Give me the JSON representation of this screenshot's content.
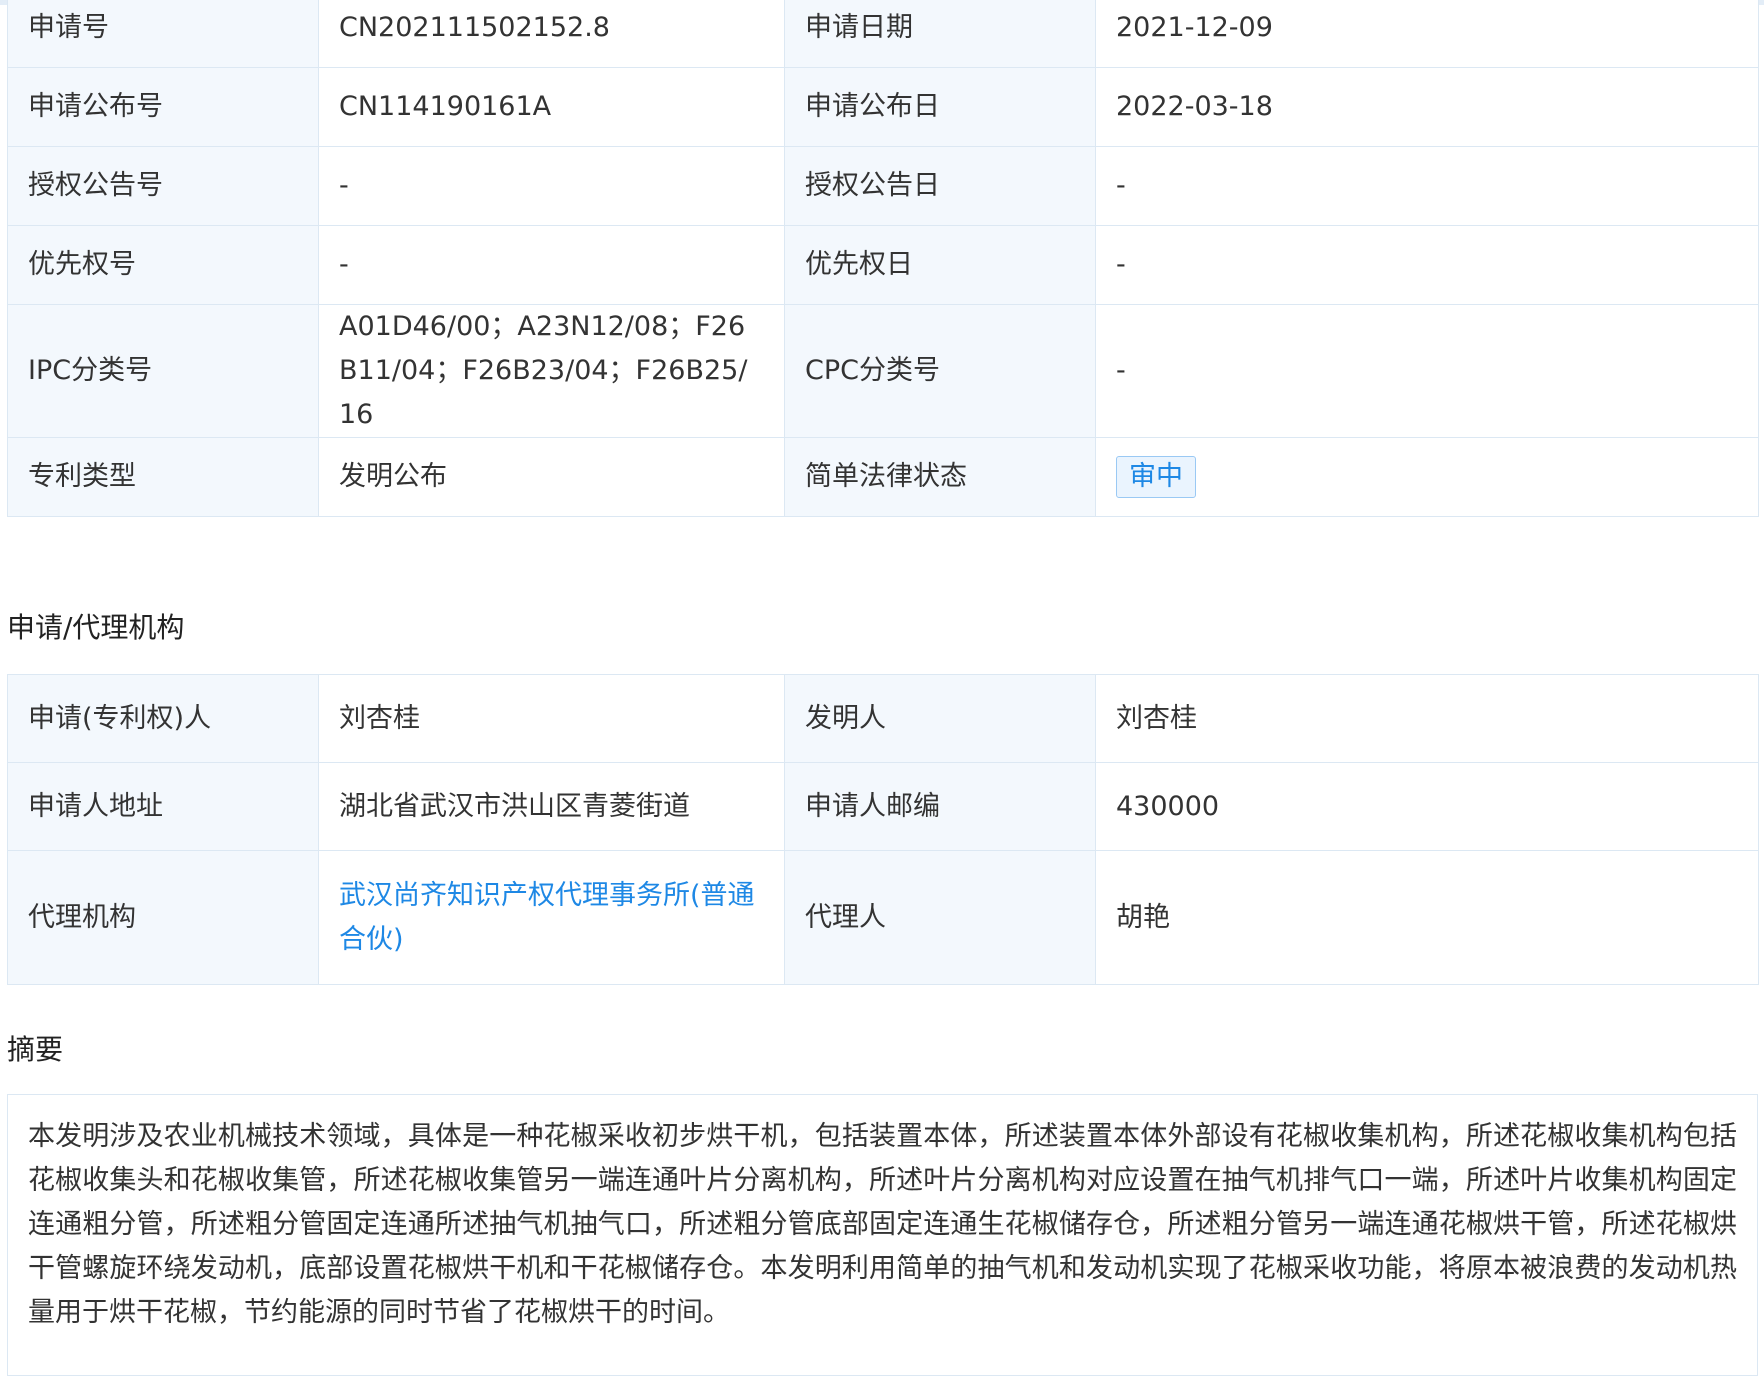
{
  "basic_info": {
    "rows": [
      {
        "label1": "申请号",
        "value1": "CN202111502152.8",
        "label2": "申请日期",
        "value2": "2021-12-09"
      },
      {
        "label1": "申请公布号",
        "value1": "CN114190161A",
        "label2": "申请公布日",
        "value2": "2022-03-18"
      },
      {
        "label1": "授权公告号",
        "value1": "-",
        "label2": "授权公告日",
        "value2": "-"
      },
      {
        "label1": "优先权号",
        "value1": "-",
        "label2": "优先权日",
        "value2": "-"
      },
      {
        "label1": "IPC分类号",
        "value1": "A01D46/00；A23N12/08；F26B11/04；F26B23/04；F26B25/16",
        "label2": "CPC分类号",
        "value2": "-"
      },
      {
        "label1": "专利类型",
        "value1": "发明公布",
        "label2": "简单法律状态",
        "value2": "审中"
      }
    ]
  },
  "agency": {
    "title": "申请/代理机构",
    "rows": [
      {
        "label1": "申请(专利权)人",
        "value1": "刘杏桂",
        "label2": "发明人",
        "value2": "刘杏桂"
      },
      {
        "label1": "申请人地址",
        "value1": "湖北省武汉市洪山区青菱街道",
        "label2": "申请人邮编",
        "value2": "430000"
      },
      {
        "label1": "代理机构",
        "value1": "武汉尚齐知识产权代理事务所(普通合伙)",
        "label2": "代理人",
        "value2": "胡艳"
      }
    ]
  },
  "abstract": {
    "title": "摘要",
    "text": "本发明涉及农业机械技术领域，具体是一种花椒采收初步烘干机，包括装置本体，所述装置本体外部设有花椒收集机构，所述花椒收集机构包括花椒收集头和花椒收集管，所述花椒收集管另一端连通叶片分离机构，所述叶片分离机构对应设置在抽气机排气口一端，所述叶片收集机构固定连通粗分管，所述粗分管固定连通所述抽气机抽气口，所述粗分管底部固定连通生花椒储存仓，所述粗分管另一端连通花椒烘干管，所述花椒烘干管螺旋环绕发动机，底部设置花椒烘干机和干花椒储存仓。本发明利用简单的抽气机和发动机实现了花椒采收功能，将原本被浪费的发动机热量用于烘干花椒，节约能源的同时节省了花椒烘干的时间。"
  },
  "colors": {
    "label_bg": "#f3f8fd",
    "border": "#dce8f3",
    "link": "#1e88e5",
    "badge_bg": "#eaf4fe",
    "badge_border": "#9ac9f4"
  }
}
